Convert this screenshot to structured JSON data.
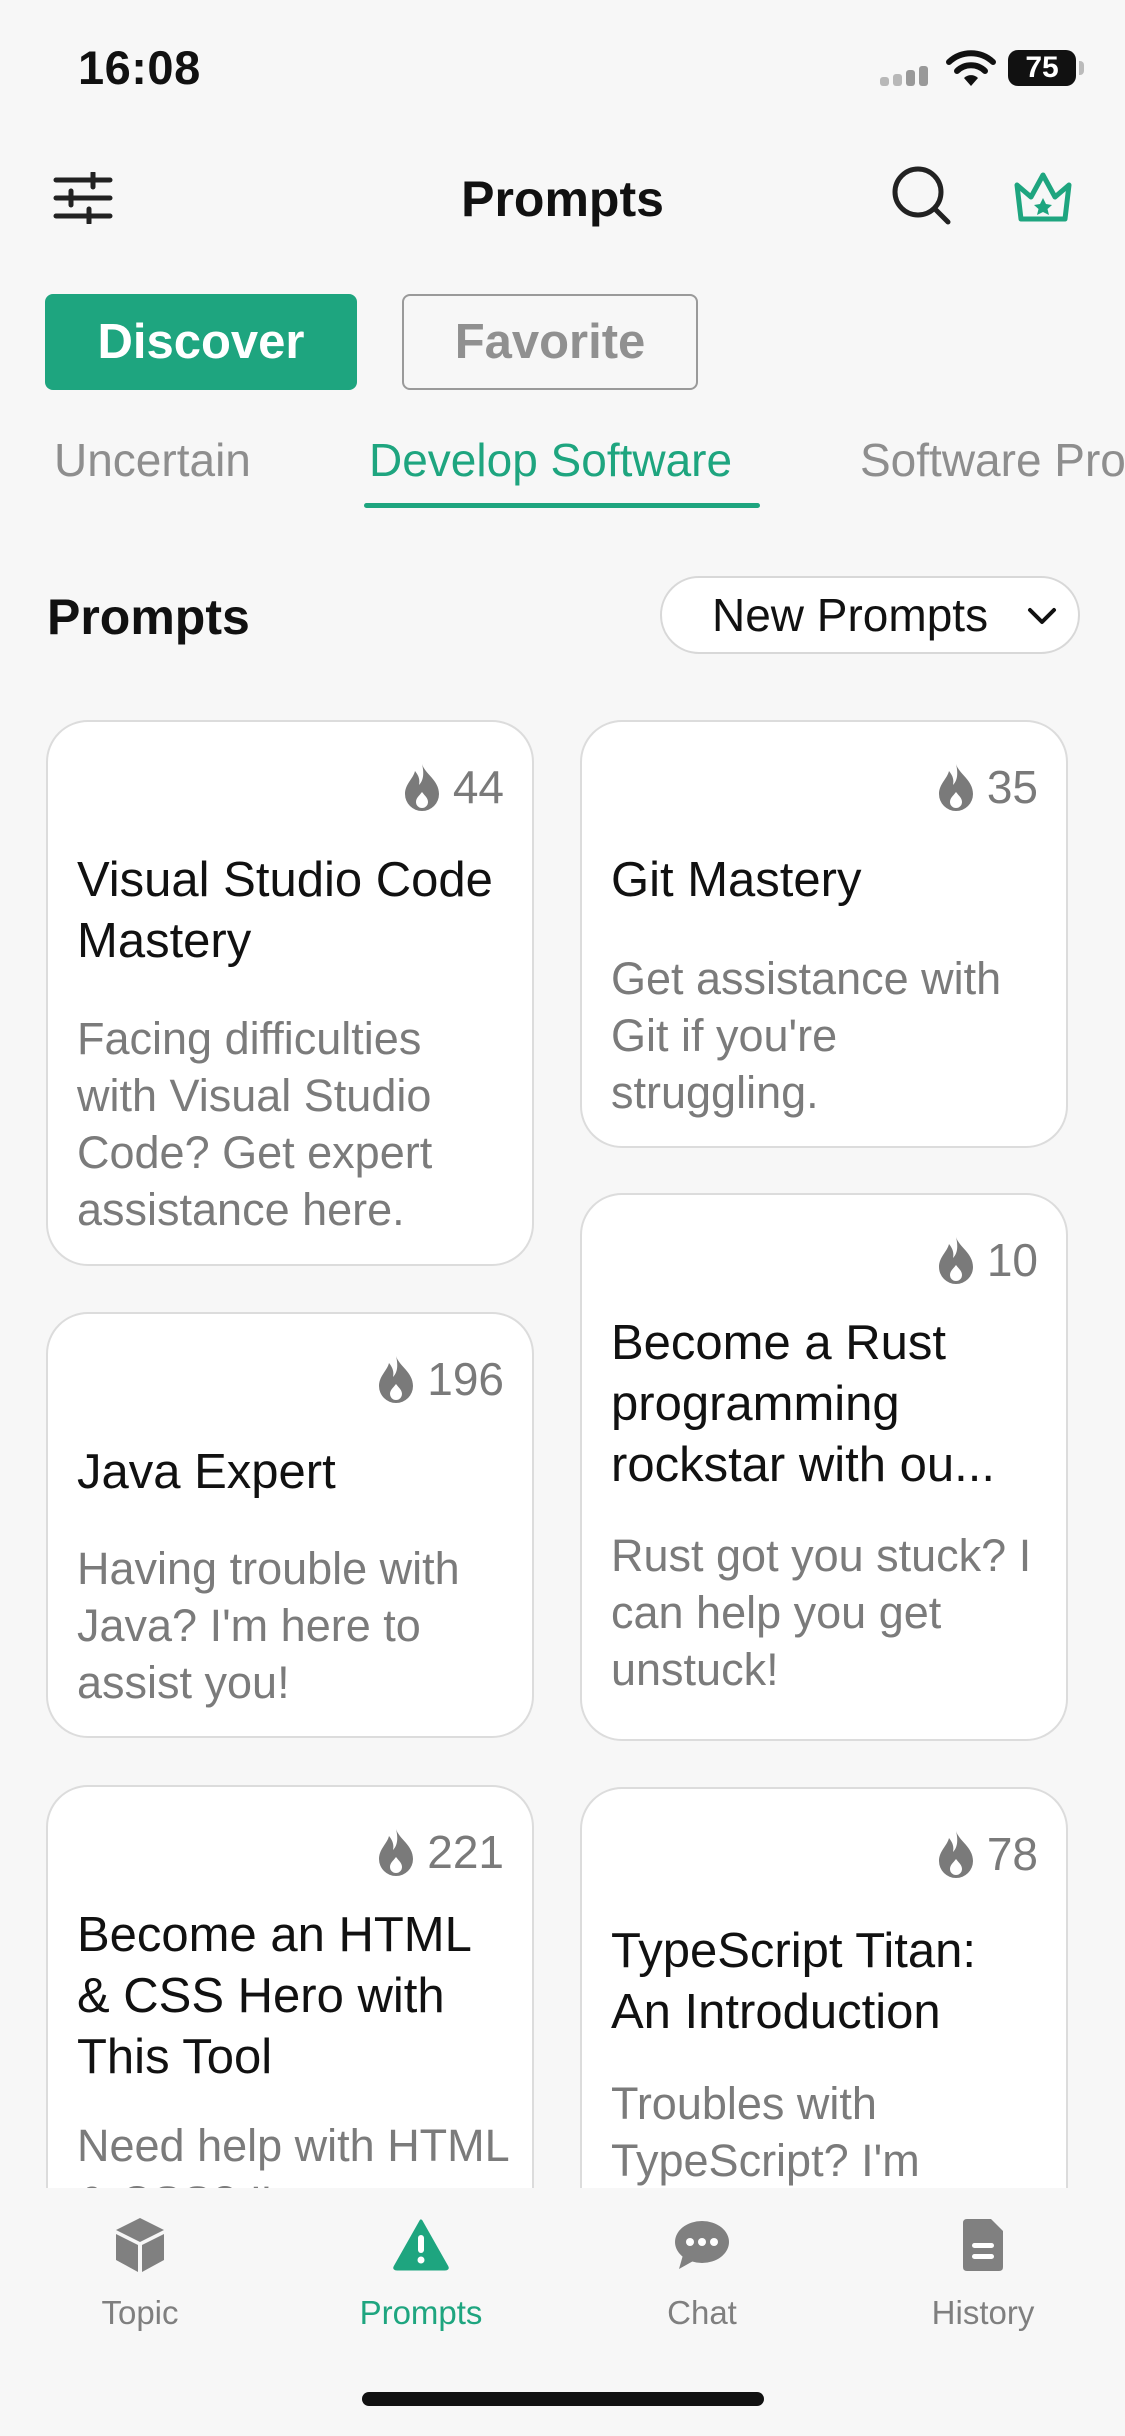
{
  "status": {
    "time": "16:08",
    "battery": "75"
  },
  "header": {
    "title": "Prompts"
  },
  "segments": {
    "discover": "Discover",
    "favorite": "Favorite"
  },
  "categories": [
    "Uncertain",
    "Develop Software",
    "Software Pro"
  ],
  "section": {
    "title": "Prompts",
    "sort_label": "New Prompts"
  },
  "cards": [
    {
      "count": "44",
      "title": "Visual Studio Code Mastery",
      "desc": "Facing difficulties with Visual Studio Code? Get expert assistance here."
    },
    {
      "count": "35",
      "title": "Git Mastery",
      "desc": "Get assistance with Git if you're struggling."
    },
    {
      "count": "196",
      "title": "Java Expert",
      "desc": "Having trouble with Java? I'm here to assist you!"
    },
    {
      "count": "10",
      "title": "Become a Rust programming rockstar with ou...",
      "desc": "Rust got you stuck? I can help you get unstuck!"
    },
    {
      "count": "221",
      "title": "Become an HTML & CSS Hero with This Tool",
      "desc": "Need help with HTML & CSS? I'm"
    },
    {
      "count": "78",
      "title": "TypeScript Titan: An Introduction",
      "desc": "Troubles with TypeScript? I'm"
    }
  ],
  "nav": {
    "topic": "Topic",
    "prompts": "Prompts",
    "chat": "Chat",
    "history": "History"
  },
  "colors": {
    "accent": "#1ea57f",
    "muted": "#8e8e8e",
    "background": "#f7f7f7"
  },
  "icons": [
    "filter-sliders-icon",
    "search-icon",
    "crown-icon",
    "flame-icon",
    "chevron-down-icon",
    "cube-icon",
    "warning-icon",
    "chat-bubble-icon",
    "document-icon"
  ]
}
